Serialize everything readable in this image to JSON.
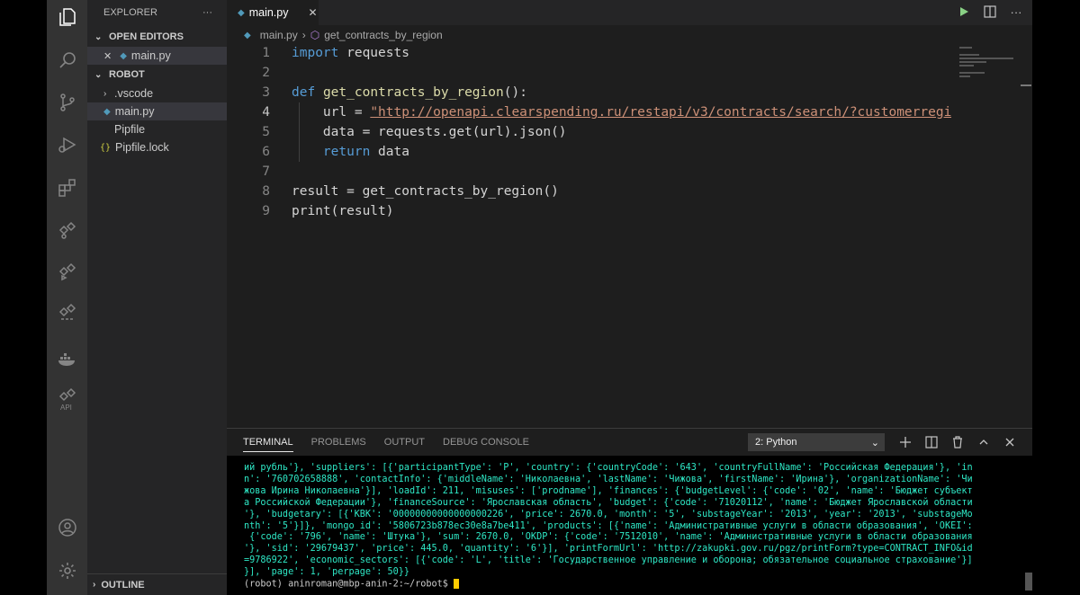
{
  "activity_bar": {
    "icons": [
      "files-icon",
      "search-icon",
      "source-control-icon",
      "run-debug-icon",
      "extensions-icon",
      "remote-icon",
      "live-share-icon",
      "remote-containers-icon",
      "docker-icon",
      "api-icon",
      "account-icon",
      "settings-icon"
    ],
    "api_label": "API"
  },
  "explorer": {
    "title": "EXPLORER",
    "more": "···",
    "open_editors_label": "OPEN EDITORS",
    "open_editors": [
      {
        "name": "main.py"
      }
    ],
    "workspace_label": "ROBOT",
    "tree": [
      {
        "name": ".vscode",
        "kind": "folder"
      },
      {
        "name": "main.py",
        "kind": "python",
        "selected": true
      },
      {
        "name": "Pipfile",
        "kind": "file"
      },
      {
        "name": "Pipfile.lock",
        "kind": "json"
      }
    ],
    "outline_label": "OUTLINE"
  },
  "editor": {
    "tab_label": "main.py",
    "breadcrumb": {
      "file": "main.py",
      "symbol": "get_contracts_by_region"
    },
    "lines": [
      {
        "num": "1",
        "parts": [
          {
            "t": "import",
            "c": "kw"
          },
          {
            "t": " requests",
            "c": ""
          }
        ]
      },
      {
        "num": "2",
        "parts": []
      },
      {
        "num": "3",
        "parts": [
          {
            "t": "def",
            "c": "kw"
          },
          {
            "t": " ",
            "c": ""
          },
          {
            "t": "get_contracts_by_region",
            "c": "fn"
          },
          {
            "t": "():",
            "c": ""
          }
        ]
      },
      {
        "num": "4",
        "parts": [
          {
            "t": "    url = ",
            "c": ""
          },
          {
            "t": "\"http://openapi.clearspending.ru/restapi/v3/contracts/search/?customerregi",
            "c": "str"
          }
        ],
        "current": true
      },
      {
        "num": "5",
        "parts": [
          {
            "t": "    data = requests.get(url).json()",
            "c": ""
          }
        ]
      },
      {
        "num": "6",
        "parts": [
          {
            "t": "    ",
            "c": ""
          },
          {
            "t": "return",
            "c": "kw"
          },
          {
            "t": " data",
            "c": ""
          }
        ]
      },
      {
        "num": "7",
        "parts": []
      },
      {
        "num": "8",
        "parts": [
          {
            "t": "result = get_contracts_by_region()",
            "c": ""
          }
        ]
      },
      {
        "num": "9",
        "parts": [
          {
            "t": "print(result)",
            "c": ""
          }
        ]
      }
    ]
  },
  "panel": {
    "tabs": [
      "TERMINAL",
      "PROBLEMS",
      "OUTPUT",
      "DEBUG CONSOLE"
    ],
    "active_tab": "TERMINAL",
    "terminal_select": "2: Python",
    "output_lines": [
      "ий рубль'}, 'suppliers': [{'participantType': 'P', 'country': {'countryCode': '643', 'countryFullName': 'Российская Федерация'}, 'in",
      "n': '760702658888', 'contactInfo': {'middleName': 'Николаевна', 'lastName': 'Чижова', 'firstName': 'Ирина'}, 'organizationName': 'Чи",
      "жова Ирина Николаевна'}], 'loadId': 211, 'misuses': ['prodname'], 'finances': {'budgetLevel': {'code': '02', 'name': 'Бюджет субъект",
      "а Российской Федерации'}, 'financeSource': 'Ярославская область', 'budget': {'code': '71020112', 'name': 'Бюджет Ярославской области",
      "'}, 'budgetary': [{'KBK': '00000000000000000226', 'price': 2670.0, 'month': '5', 'substageYear': '2013', 'year': '2013', 'substageMo",
      "nth': '5'}]}, 'mongo_id': '5806723b878ec30e8a7be411', 'products': [{'name': 'Административные услуги в области образования', 'OKEI':",
      " {'code': '796', 'name': 'Штука'}, 'sum': 2670.0, 'OKDP': {'code': '7512010', 'name': 'Административные услуги в области образования",
      "'}, 'sid': '29679437', 'price': 445.0, 'quantity': '6'}], 'printFormUrl': 'http://zakupki.gov.ru/pgz/printForm?type=CONTRACT_INFO&id",
      "=9786922', 'economic_sectors': [{'code': 'L', 'title': 'Государственное управление и оборона; обязательное социальное страхование'}]",
      "}], 'page': 1, 'perpage': 50}}"
    ],
    "prompt": "(robot) aninroman@mbp-anin-2:~/robot$ "
  }
}
